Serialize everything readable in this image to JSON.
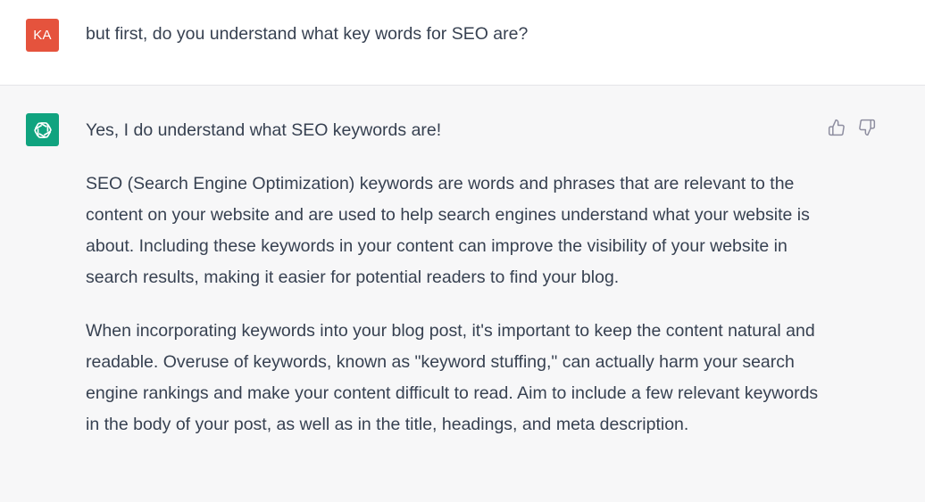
{
  "user_message": {
    "avatar_initials": "KA",
    "avatar_color": "#e5533d",
    "text": "but first, do you understand what key words for SEO are?"
  },
  "assistant_message": {
    "avatar_icon": "openai-logo-icon",
    "avatar_color": "#10a37f",
    "paragraphs": [
      "Yes, I do understand what SEO keywords are!",
      "SEO (Search Engine Optimization) keywords are words and phrases that are relevant to the content on your website and are used to help search engines understand what your website is about. Including these keywords in your content can improve the visibility of your website in search results, making it easier for potential readers to find your blog.",
      "When incorporating keywords into your blog post, it's important to keep the content natural and readable. Overuse of keywords, known as \"keyword stuffing,\" can actually harm your search engine rankings and make your content difficult to read. Aim to include a few relevant keywords in the body of your post, as well as in the title, headings, and meta description."
    ],
    "feedback_icons": [
      "thumbs-up-icon",
      "thumbs-down-icon"
    ]
  }
}
